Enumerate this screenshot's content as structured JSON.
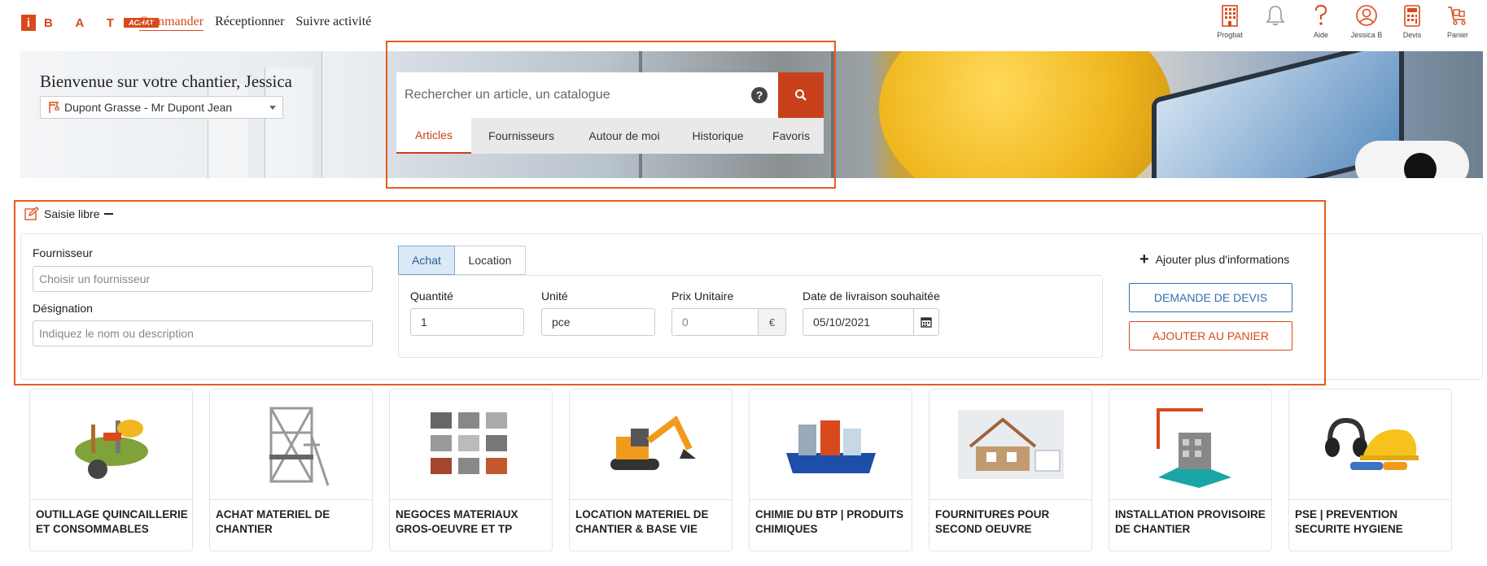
{
  "brand": {
    "logo_letters": "B A T",
    "logo_i": "i",
    "logo_tag": "ACHAT",
    "accent": "#d84a1b"
  },
  "nav": {
    "items": [
      "Commander",
      "Réceptionner",
      "Suivre activité"
    ],
    "active": "Commander"
  },
  "top_icons": [
    {
      "icon": "building-icon",
      "label": "Progbat"
    },
    {
      "icon": "bell-icon",
      "label": ""
    },
    {
      "icon": "question-icon",
      "label": "Aide"
    },
    {
      "icon": "user-icon",
      "label": "Jessica B"
    },
    {
      "icon": "calculator-icon",
      "label": "Devis"
    },
    {
      "icon": "cart-icon",
      "label": "Panier"
    }
  ],
  "hero": {
    "title": "Bienvenue sur votre chantier, Jessica",
    "site_selected": "Dupont Grasse - Mr Dupont Jean"
  },
  "search": {
    "placeholder": "Rechercher un article, un catalogue",
    "tabs": [
      "Articles",
      "Fournisseurs",
      "Autour de moi",
      "Historique",
      "Favoris"
    ],
    "active_tab": "Articles"
  },
  "saisie": {
    "title": "Saisie libre",
    "fournisseur_label": "Fournisseur",
    "fournisseur_placeholder": "Choisir un fournisseur",
    "designation_label": "Désignation",
    "designation_placeholder": "Indiquez le nom ou description",
    "modes": [
      "Achat",
      "Location"
    ],
    "active_mode": "Achat",
    "quantite_label": "Quantité",
    "quantite_value": "1",
    "unite_label": "Unité",
    "unite_value": "pce",
    "prix_label": "Prix Unitaire",
    "prix_placeholder": "0",
    "currency": "€",
    "date_label": "Date de livraison souhaitée",
    "date_value": "05/10/2021",
    "more_info": "Ajouter plus d'informations",
    "btn_devis": "DEMANDE DE DEVIS",
    "btn_panier": "AJOUTER AU PANIER"
  },
  "categories": [
    {
      "name": "OUTILLAGE QUINCAILLERIE ET CONSOMMABLES"
    },
    {
      "name": "ACHAT MATERIEL DE CHANTIER"
    },
    {
      "name": "NEGOCES MATERIAUX GROS-OEUVRE ET TP"
    },
    {
      "name": "LOCATION MATERIEL DE CHANTIER & BASE VIE"
    },
    {
      "name": "CHIMIE DU BTP | PRODUITS CHIMIQUES"
    },
    {
      "name": "FOURNITURES POUR SECOND OEUVRE"
    },
    {
      "name": "INSTALLATION PROVISOIRE DE CHANTIER"
    },
    {
      "name": "PSE | PREVENTION SECURITE HYGIENE"
    }
  ]
}
